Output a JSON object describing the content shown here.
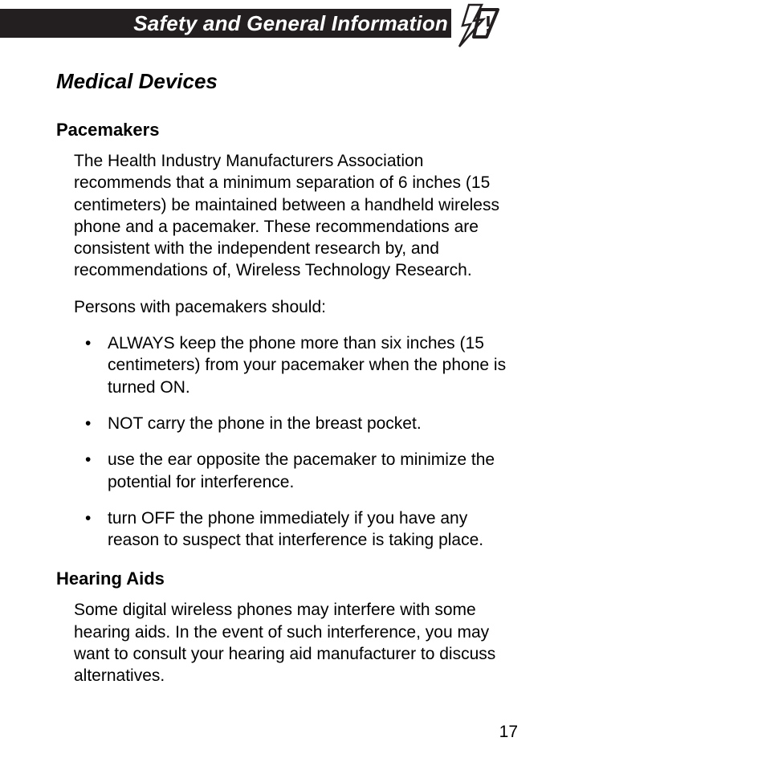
{
  "header": {
    "title": "Safety and General Information"
  },
  "section": {
    "title": "Medical Devices",
    "pacemakers": {
      "heading": "Pacemakers",
      "p1": "The Health Industry Manufacturers Association recommends that a minimum separation of 6 inches (15 centimeters) be maintained between a handheld wireless phone and a pacemaker. These recommendations are consistent with the independent research by, and recommendations of, Wireless Technology Research.",
      "p2": "Persons with pacemakers should:",
      "bullets": [
        "ALWAYS keep the phone more than six inches (15 centimeters) from your pacemaker when the phone is turned ON.",
        "NOT carry the phone in the breast pocket.",
        "use the ear opposite the pacemaker to minimize the potential for interference.",
        "turn OFF the phone immediately if you have any reason to suspect that interference is taking place."
      ]
    },
    "hearing_aids": {
      "heading": "Hearing Aids",
      "p1": "Some digital wireless phones may interfere with some hearing aids. In the event of such interference, you may want to consult your hearing aid manufacturer to discuss alternatives."
    }
  },
  "page_number": "17"
}
